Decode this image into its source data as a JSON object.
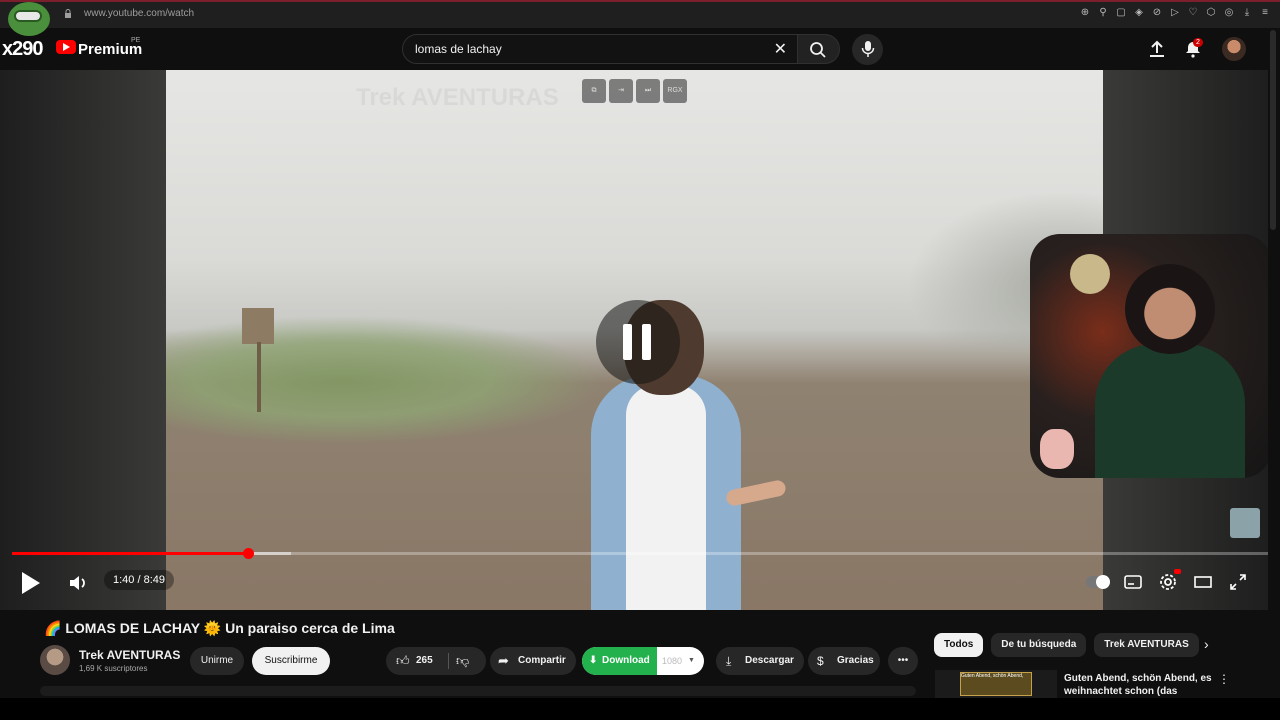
{
  "browser": {
    "url": "www.youtube.com/watch"
  },
  "header": {
    "logo_prefix": "x290",
    "logo_text": "Premium",
    "region": "PE",
    "search_value": "lomas de lachay",
    "notification_count": "2"
  },
  "player": {
    "watermark": "Trek AVENTURAS",
    "ext_button_label": "RGX",
    "time": "1:40 / 8:49",
    "progress_fraction": 0.188,
    "buffer_fraction": 0.222
  },
  "video": {
    "title": "🌈 LOMAS DE LACHAY 🌞 Un paraiso cerca de Lima",
    "channel": "Trek AVENTURAS",
    "subscribers": "1,69 K suscriptores",
    "join_label": "Unirme",
    "subscribe_label": "Suscribirme",
    "likes": "265",
    "share_label": "Compartir",
    "download_label": "Download",
    "download_quality": "1080",
    "descargar_label": "Descargar",
    "thanks_label": "Gracias"
  },
  "chips": [
    "Todos",
    "De tu búsqueda",
    "Trek AVENTURAS"
  ],
  "recommendation": {
    "title": "Guten Abend, schön Abend, es weihnachtet schon (das",
    "thumb_text": "Guten Abend, schön Abend,"
  },
  "colors": {
    "accent": "#ff0000",
    "download": "#22b14c"
  }
}
